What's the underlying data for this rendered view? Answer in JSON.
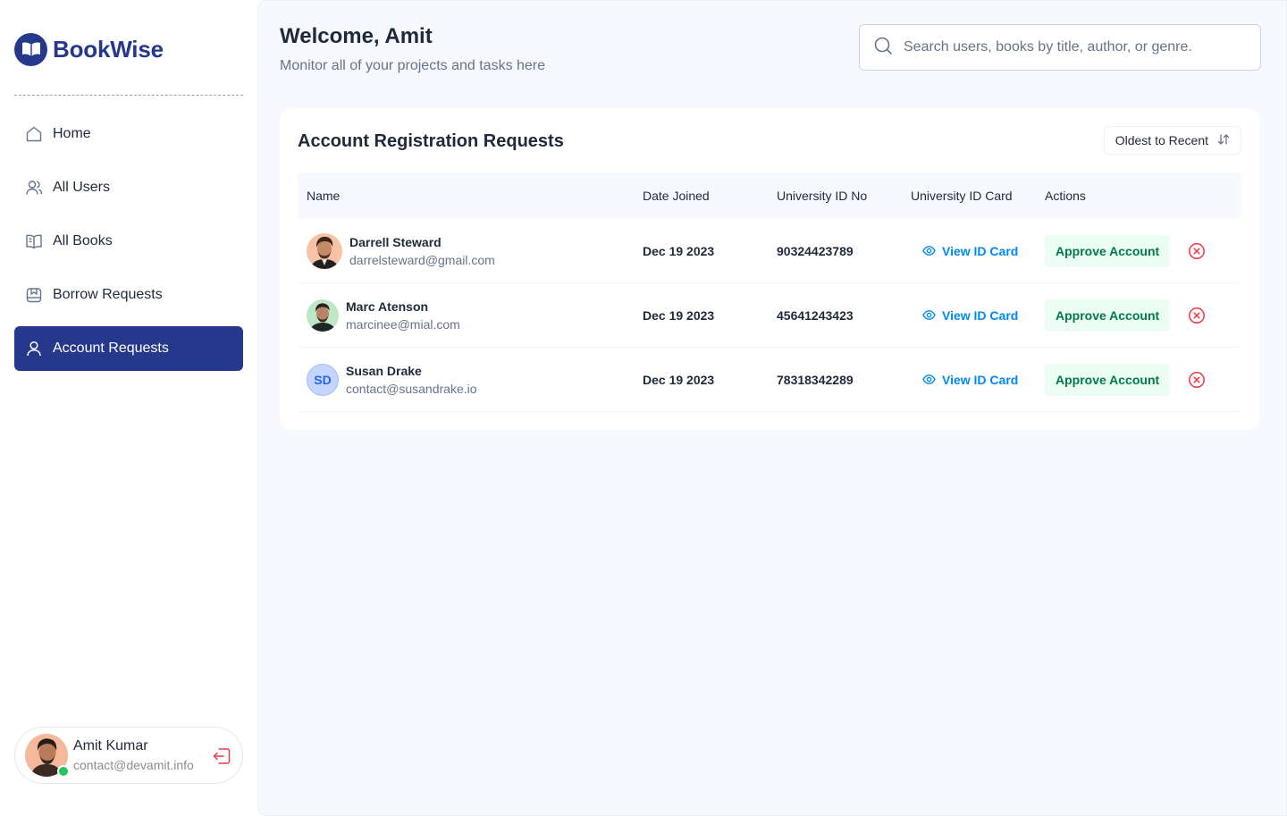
{
  "brand": {
    "name": "BookWise",
    "logo_icon": "open-book-icon",
    "color": "#25388c"
  },
  "sidebar": {
    "items": [
      {
        "label": "Home",
        "icon": "home-icon"
      },
      {
        "label": "All Users",
        "icon": "users-icon"
      },
      {
        "label": "All Books",
        "icon": "book-icon"
      },
      {
        "label": "Borrow Requests",
        "icon": "bookmark-icon"
      },
      {
        "label": "Account Requests",
        "icon": "user-icon",
        "active": true
      }
    ],
    "user": {
      "name": "Amit Kumar",
      "email": "contact@devamit.info",
      "status": "online"
    }
  },
  "header": {
    "title": "Welcome, Amit",
    "subtitle": "Monitor all of your projects and tasks here",
    "search_placeholder": "Search users, books by title, author, or genre."
  },
  "panel": {
    "title": "Account Registration Requests",
    "sort_label": "Oldest to Recent",
    "columns": [
      "Name",
      "Date Joined",
      "University ID No",
      "University ID Card",
      "Actions"
    ],
    "rows": [
      {
        "name": "Darrell Steward",
        "email": "darrelsteward@gmail.com",
        "date": "Dec 19 2023",
        "uid": "90324423789",
        "card_label": "View ID Card",
        "approve_label": "Approve Account",
        "avatar": "photo"
      },
      {
        "name": "Marc Atenson",
        "email": "marcinee@mial.com",
        "date": "Dec 19 2023",
        "uid": "45641243423",
        "card_label": "View ID Card",
        "approve_label": "Approve Account",
        "avatar": "photo"
      },
      {
        "name": "Susan Drake",
        "email": "contact@susandrake.io",
        "date": "Dec 19 2023",
        "uid": "78318342289",
        "card_label": "View ID Card",
        "approve_label": "Approve Account",
        "avatar_initials": "SD"
      }
    ]
  },
  "colors": {
    "link": "#0089f1",
    "approve_bg": "#ecfdf3",
    "approve_text": "#027a48",
    "reject": "#ef3a4b",
    "online": "#22c55e"
  }
}
